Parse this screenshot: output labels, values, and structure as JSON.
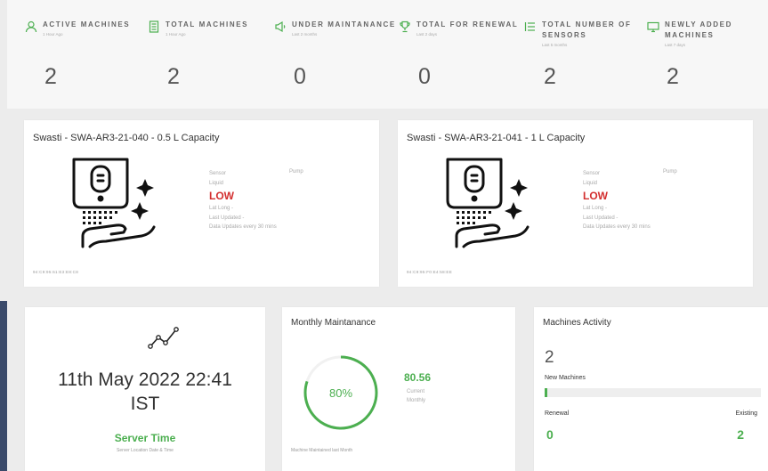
{
  "stats": [
    {
      "title": "ACTIVE MACHINES",
      "sub": "1 Hour Ago",
      "value": "2",
      "icon": "person-icon"
    },
    {
      "title": "TOTAL MACHINES",
      "sub": "1 Hour Ago",
      "value": "2",
      "icon": "document-icon"
    },
    {
      "title": "UNDER MAINTANANCE",
      "sub": "Last 2 months",
      "value": "0",
      "icon": "megaphone-icon"
    },
    {
      "title": "TOTAL FOR RENEWAL",
      "sub": "Last 2 days",
      "value": "0",
      "icon": "trophy-icon"
    },
    {
      "title": "TOTAL NUMBER OF SENSORS",
      "sub": "Last 5 months",
      "value": "2",
      "icon": "list-icon"
    },
    {
      "title": "NEWLY ADDED MACHINES",
      "sub": "Last 7 days",
      "value": "2",
      "icon": "monitor-icon"
    }
  ],
  "machines": [
    {
      "title": "Swasti - SWA-AR3-21-040 - 0.5 L Capacity",
      "sensor": "Sensor",
      "pump": "Pump",
      "liquid": "Liquid",
      "level": "LOW",
      "latlong": "Lat Long -",
      "last_updated": "Last Updated -",
      "update_note": "Data Updates every 30 mins",
      "mac": "94:C9:95:61:E3:E8:C8"
    },
    {
      "title": "Swasti - SWA-AR3-21-041 - 1 L Capacity",
      "sensor": "Sensor",
      "pump": "Pump",
      "liquid": "Liquid",
      "level": "LOW",
      "latlong": "Lat Long -",
      "last_updated": "Last Updated -",
      "update_note": "Data Updates every 30 mins",
      "mac": "94:C9:95:F0:E4:58:EE"
    }
  ],
  "server": {
    "datetime_line1": "11th May 2022 22:41",
    "datetime_line2": "IST",
    "label": "Server Time",
    "sub": "Server Location Date & Time"
  },
  "maintenance": {
    "title": "Monthly Maintanance",
    "percent_label": "80%",
    "percent": 0.8,
    "value": "80.56",
    "sub1": "Current",
    "sub2": "Monthly",
    "footer": "Machine Maintained last Month"
  },
  "activity": {
    "title": "Machines Activity",
    "count": "2",
    "new_label": "New Machines",
    "bar_fraction": 0.01,
    "renewal_label": "Renewal",
    "existing_label": "Existing",
    "renewal_value": "0",
    "existing_value": "2"
  },
  "colors": {
    "accent": "#4caf50",
    "low": "#d32f2f"
  }
}
